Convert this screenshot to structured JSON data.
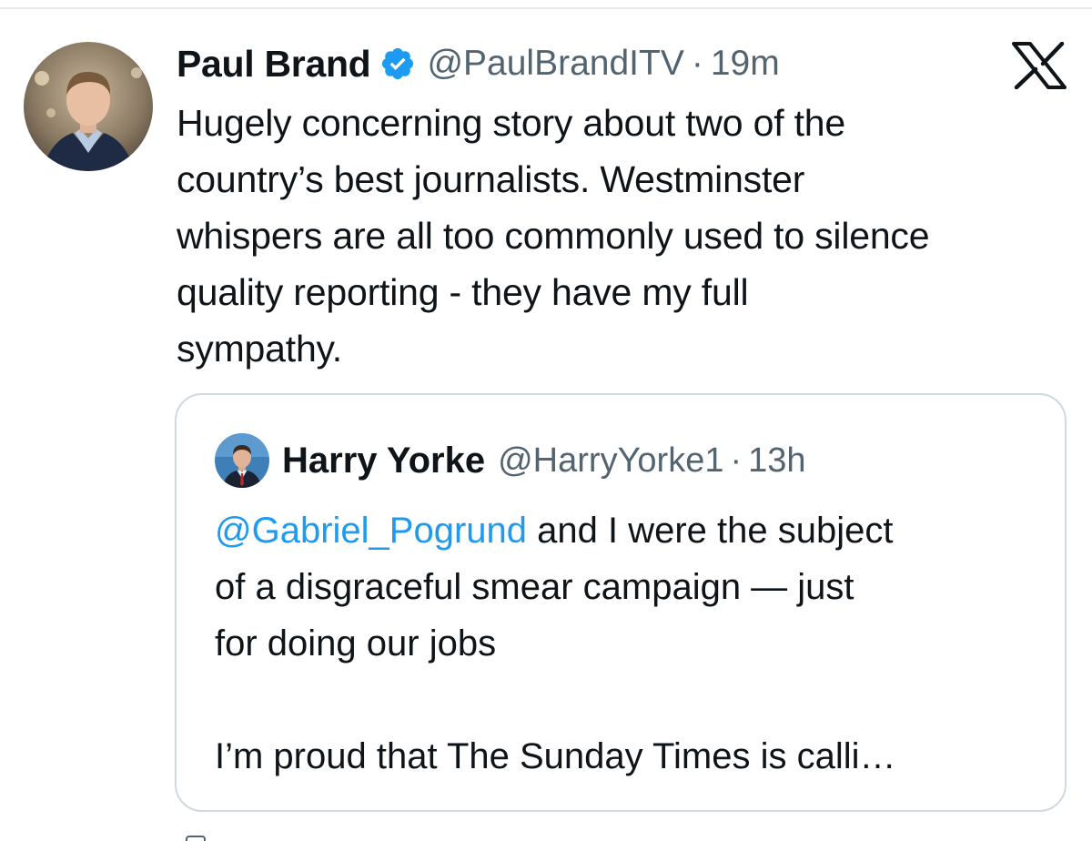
{
  "tweet": {
    "author_name": "Paul Brand",
    "verified": true,
    "handle": "@PaulBrandITV",
    "separator": "·",
    "time": "19m",
    "text": "Hugely concerning story about two of the\ncountry’s best journalists. Westminster\nwhispers are all too commonly used to silence\nquality reporting - they have my full\nsympathy.",
    "verified_icon": "verified-badge-icon",
    "platform_icon": "x-logo-icon"
  },
  "quote": {
    "author_name": "Harry Yorke",
    "handle": "@HarryYorke1",
    "separator": "·",
    "time": "13h",
    "mention": "@Gabriel_Pogrund",
    "text_line1_rest": " and I were the subject\nof a disgraceful smear campaign — just\nfor doing our jobs",
    "text_para2": "I’m proud that The Sunday Times is calli…"
  },
  "colors": {
    "link": "#1d9bf0",
    "verified": "#1d9bf0",
    "secondary_text": "#536471",
    "border": "#cfd9de"
  }
}
